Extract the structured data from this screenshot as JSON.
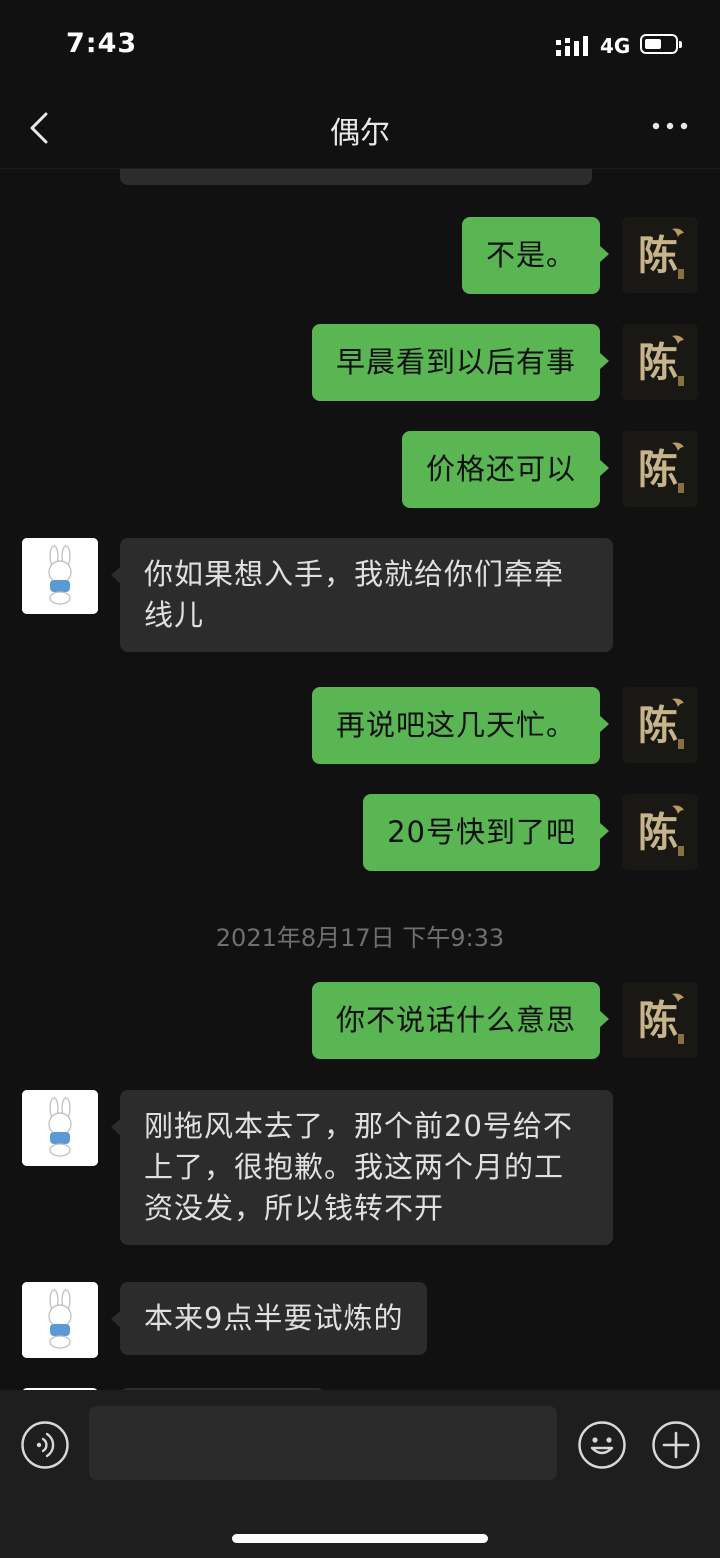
{
  "status_bar": {
    "time": "7:43",
    "network": "4G"
  },
  "header": {
    "title": "偶尔",
    "back_icon": "chevron-left-icon",
    "more_icon": "more-dots-icon"
  },
  "avatars": {
    "me_glyph": "陈"
  },
  "messages": [
    {
      "from": "me",
      "text": "不是。"
    },
    {
      "from": "me",
      "text": "早晨看到以后有事"
    },
    {
      "from": "me",
      "text": "价格还可以"
    },
    {
      "from": "them",
      "text": "你如果想入手，我就给你们牵牵线儿"
    },
    {
      "from": "me",
      "text": "再说吧这几天忙。"
    },
    {
      "from": "me",
      "text": "20号快到了吧"
    },
    {
      "from": "me",
      "text": "你不说话什么意思"
    },
    {
      "from": "them",
      "text": "刚拖风本去了，那个前20号给不上了，很抱歉。我这两个月的工资没发，所以钱转不开"
    },
    {
      "from": "them",
      "text": "本来9点半要试炼的"
    }
  ],
  "timestamp": "2021年8月17日 下午9:33",
  "colors": {
    "sent_bubble": "#5ab553",
    "received_bubble": "#2c2c2c",
    "background": "#111111",
    "input_bar": "#1e1e1e"
  }
}
